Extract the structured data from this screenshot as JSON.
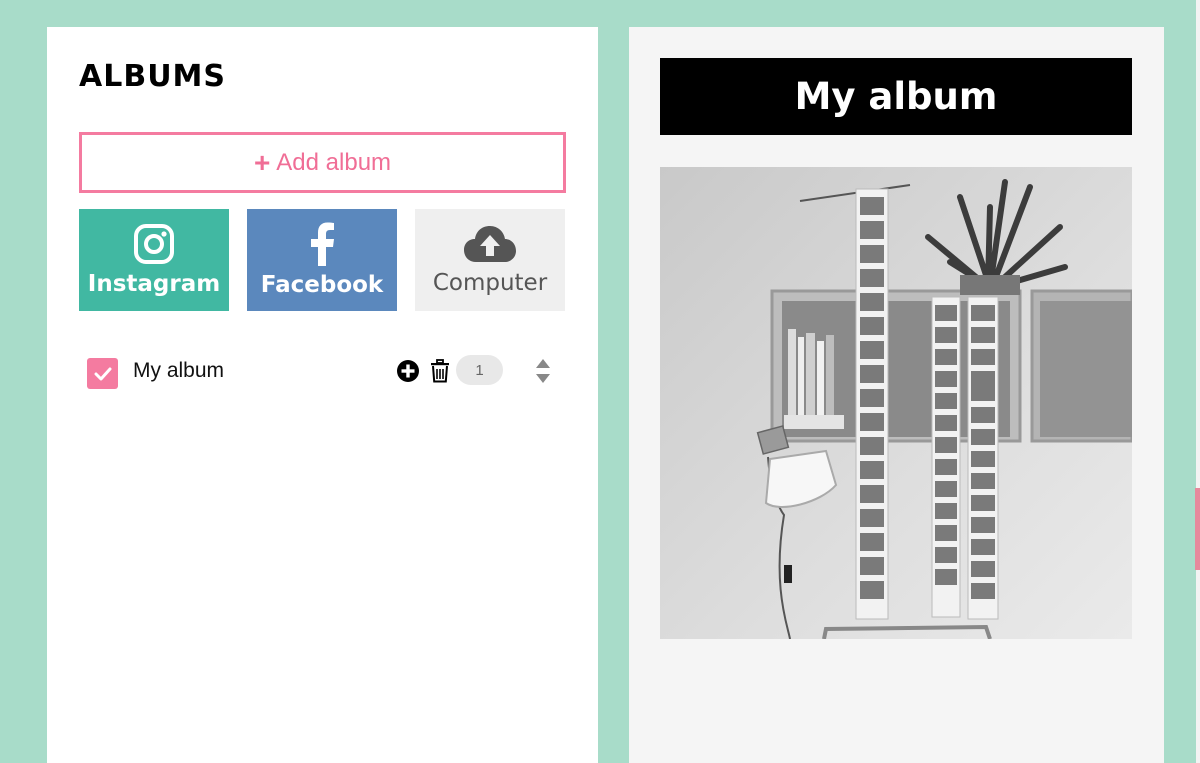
{
  "sidebar": {
    "title": "ALBUMS",
    "add_album_icon": "+",
    "add_album_label": "Add album",
    "sources": [
      {
        "label": "Instagram",
        "icon": "instagram-icon",
        "color": "#41b8a2"
      },
      {
        "label": "Facebook",
        "icon": "facebook-icon",
        "color": "#5b88bd"
      },
      {
        "label": "Computer",
        "icon": "cloud-upload-icon",
        "color": "#efefef"
      }
    ],
    "albums": [
      {
        "name": "My album",
        "checked": true,
        "count": "1"
      }
    ]
  },
  "preview": {
    "title": "My album"
  },
  "colors": {
    "background": "#a8dcc9",
    "accent_pink": "#f47ba0",
    "instagram": "#41b8a2",
    "facebook": "#5b88bd"
  }
}
